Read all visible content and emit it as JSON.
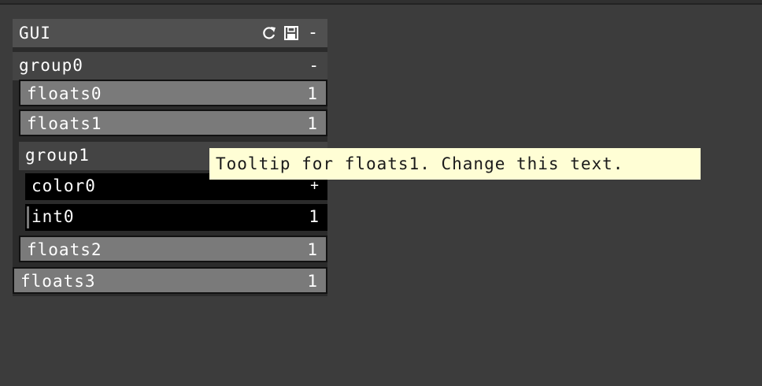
{
  "panel": {
    "title": "GUI",
    "icons": [
      "refresh-icon",
      "save-icon",
      "minimize-icon"
    ],
    "minimize_label": "-"
  },
  "group0": {
    "label": "group0",
    "toggle": "-",
    "floats0": {
      "label": "floats0",
      "value": "1"
    },
    "floats1": {
      "label": "floats1",
      "value": "1"
    },
    "group1": {
      "label": "group1",
      "color0": {
        "label": "color0",
        "toggle": "+"
      },
      "int0": {
        "label": "int0",
        "value": "1"
      }
    },
    "floats2": {
      "label": "floats2",
      "value": "1"
    }
  },
  "floats3": {
    "label": "floats3",
    "value": "1"
  },
  "tooltip": {
    "text": "Tooltip for floats1. Change this text."
  },
  "colors": {
    "background": "#3c3c3c",
    "panel_header": "#505050",
    "slider_fill": "#7a7a7a",
    "tooltip_bg": "#fffed5"
  }
}
